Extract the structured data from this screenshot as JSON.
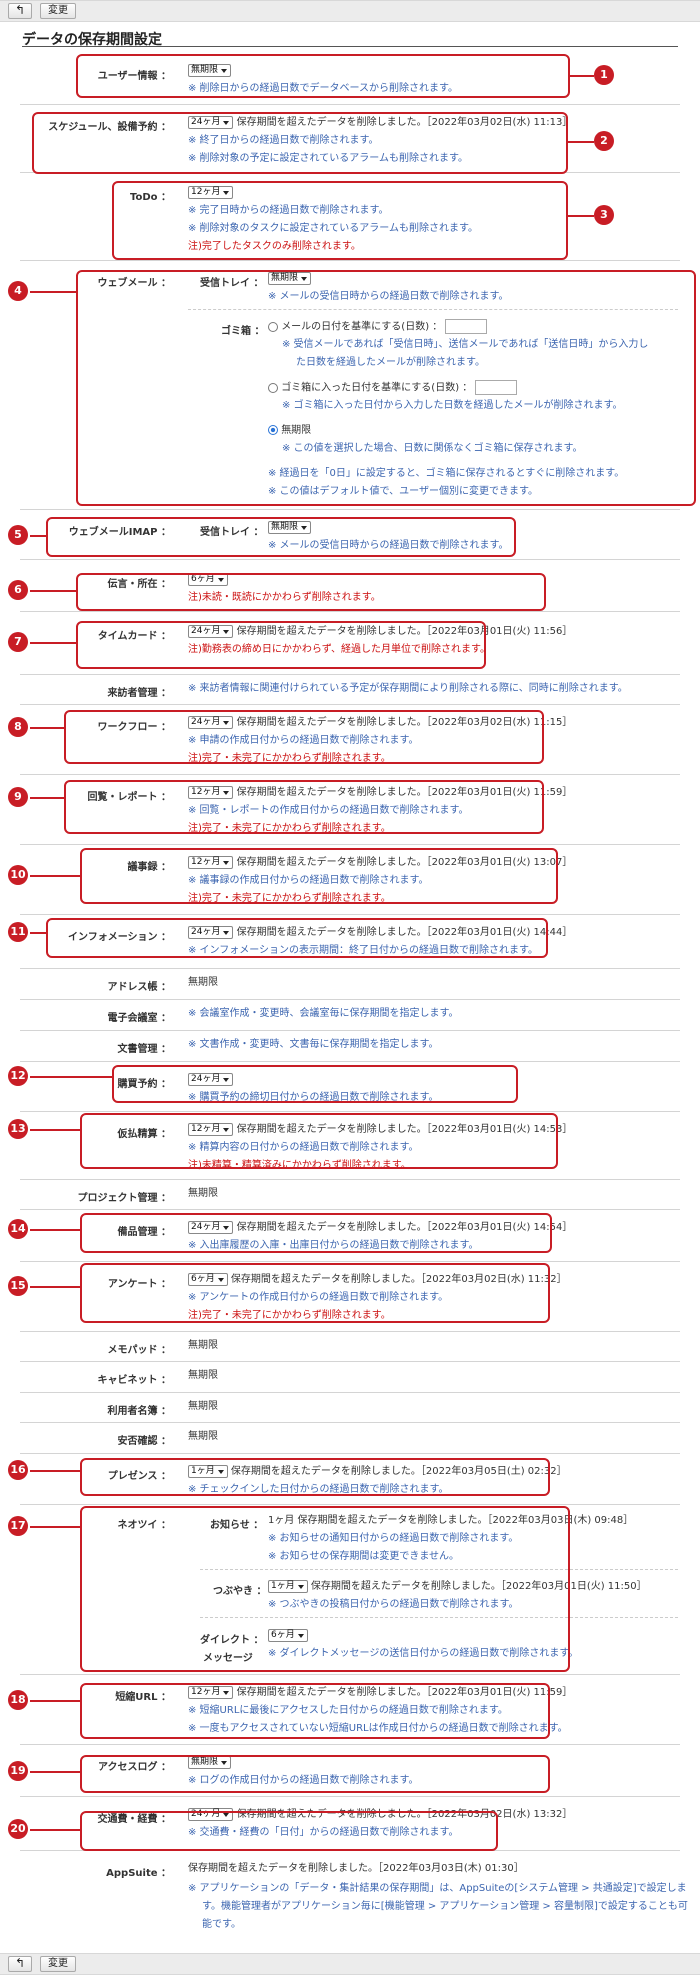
{
  "toolbar": {
    "back_icon": "↰",
    "change_label": "変更"
  },
  "page_title": "データの保存期間設定",
  "user": {
    "label": "ユーザー情報 ：",
    "select": "無期限",
    "note": "※ 削除日からの経過日数でデータベースから削除されます。"
  },
  "schedule": {
    "label": "スケジュール、設備予約 ：",
    "select": "24ヶ月",
    "text": "保存期間を超えたデータを削除しました。［2022年03月02日(水) 11:13］",
    "note1": "※ 終了日からの経過日数で削除されます。",
    "note2": "※ 削除対象の予定に設定されているアラームも削除されます。"
  },
  "todo": {
    "label": "ToDo ：",
    "select": "12ヶ月",
    "note1": "※ 完了日時からの経過日数で削除されます。",
    "note2": "※ 削除対象のタスクに設定されているアラームも削除されます。",
    "note3": "注)完了したタスクのみ削除されます。"
  },
  "webmail": {
    "label": "ウェブメール ：",
    "inbox_label": "受信トレイ ：",
    "inbox_select": "無期限",
    "inbox_note": "※ メールの受信日時からの経過日数で削除されます。",
    "trash_label": "ゴミ箱 ：",
    "opt1": "メールの日付を基準にする(日数) ：",
    "opt1_note1": "※ 受信メールであれば「受信日時」、送信メールであれば「送信日時」から入力し",
    "opt1_note2": "た日数を経過したメールが削除されます。",
    "opt2": "ゴミ箱に入った日付を基準にする(日数) ：",
    "opt2_note": "※ ゴミ箱に入った日付から入力した日数を経過したメールが削除されます。",
    "opt3": "無期限",
    "opt3_note": "※ この値を選択した場合、日数に関係なくゴミ箱に保存されます。",
    "note_a": "※ 経過日を「0日」に設定すると、ゴミ箱に保存されるとすぐに削除されます。",
    "note_b": "※ この値はデフォルト値で、ユーザー個別に変更できます。"
  },
  "imap": {
    "label": "ウェブメールIMAP ：",
    "inbox_label": "受信トレイ ：",
    "inbox_select": "無期限",
    "inbox_note": "※ メールの受信日時からの経過日数で削除されます。"
  },
  "message": {
    "label": "伝言・所在 ：",
    "select": "6ヶ月",
    "note": "注)未読・既読にかかわらず削除されます。"
  },
  "timecard": {
    "label": "タイムカード ：",
    "select": "24ヶ月",
    "text": "保存期間を超えたデータを削除しました。［2022年03月01日(火) 11:56］",
    "note": "注)勤務表の締め日にかかわらず、経過した月単位で削除されます。"
  },
  "visitor": {
    "label": "来訪者管理 ：",
    "note": "※ 来訪者情報に関連付けられている予定が保存期間により削除される際に、同時に削除されます。"
  },
  "workflow": {
    "label": "ワークフロー ：",
    "select": "24ヶ月",
    "text": "保存期間を超えたデータを削除しました。［2022年03月02日(水) 11:15］",
    "note1": "※ 申請の作成日付からの経過日数で削除されます。",
    "note2": "注)完了・未完了にかかわらず削除されます。"
  },
  "circular": {
    "label": "回覧・レポート ：",
    "select": "12ヶ月",
    "text": "保存期間を超えたデータを削除しました。［2022年03月01日(火) 11:59］",
    "note1": "※ 回覧・レポートの作成日付からの経過日数で削除されます。",
    "note2": "注)完了・未完了にかかわらず削除されます。"
  },
  "minutes": {
    "label": "議事録 ：",
    "select": "12ヶ月",
    "text": "保存期間を超えたデータを削除しました。［2022年03月01日(火) 13:07］",
    "note1": "※ 議事録の作成日付からの経過日数で削除されます。",
    "note2": "注)完了・未完了にかかわらず削除されます。"
  },
  "info": {
    "label": "インフォメーション ：",
    "select": "24ヶ月",
    "text": "保存期間を超えたデータを削除しました。［2022年03月01日(火) 14:44］",
    "note": "※ インフォメーションの表示期間：終了日付からの経過日数で削除されます。"
  },
  "address": {
    "label": "アドレス帳 ：",
    "text": "無期限"
  },
  "conference": {
    "label": "電子会議室 ：",
    "note": "※ 会議室作成・変更時、会議室毎に保存期間を指定します。"
  },
  "docs": {
    "label": "文書管理 ：",
    "note": "※ 文書作成・変更時、文書毎に保存期間を指定します。"
  },
  "purchase": {
    "label": "購買予約 ：",
    "select": "24ヶ月",
    "note": "※ 購買予約の締切日付からの経過日数で削除されます。"
  },
  "expense": {
    "label": "仮払精算 ：",
    "select": "12ヶ月",
    "text": "保存期間を超えたデータを削除しました。［2022年03月01日(火) 14:53］",
    "note1": "※ 精算内容の日付からの経過日数で削除されます。",
    "note2": "注)未精算・精算済みにかかわらず削除されます。"
  },
  "project": {
    "label": "プロジェクト管理 ：",
    "text": "無期限"
  },
  "equipment": {
    "label": "備品管理 ：",
    "select": "24ヶ月",
    "text": "保存期間を超えたデータを削除しました。［2022年03月01日(火) 14:54］",
    "note": "※ 入出庫履歴の入庫・出庫日付からの経過日数で削除されます。"
  },
  "survey": {
    "label": "アンケート ：",
    "select": "6ヶ月",
    "text": "保存期間を超えたデータを削除しました。［2022年03月02日(水) 11:32］",
    "note1": "※ アンケートの作成日付からの経過日数で削除されます。",
    "note2": "注)完了・未完了にかかわらず削除されます。"
  },
  "memo": {
    "label": "メモパッド ：",
    "text": "無期限"
  },
  "cabinet": {
    "label": "キャビネット ：",
    "text": "無期限"
  },
  "userlist": {
    "label": "利用者名簿 ：",
    "text": "無期限"
  },
  "safety": {
    "label": "安否確認 ：",
    "text": "無期限"
  },
  "presence": {
    "label": "プレゼンス ：",
    "select": "1ヶ月",
    "text": "保存期間を超えたデータを削除しました。［2022年03月05日(土) 02:32］",
    "note": "※ チェックインした日付からの経過日数で削除されます。"
  },
  "neotwi": {
    "label": "ネオツイ ：",
    "notice_label": "お知らせ ：",
    "notice_text": "1ヶ月 保存期間を超えたデータを削除しました。［2022年03月03日(木) 09:48］",
    "notice_note1": "※ お知らせの通知日付からの経過日数で削除されます。",
    "notice_note2": "※ お知らせの保存期間は変更できません。",
    "tweet_label": "つぶやき ：",
    "tweet_select": "1ヶ月",
    "tweet_text": "保存期間を超えたデータを削除しました。［2022年03月01日(火) 11:50］",
    "tweet_note": "※ つぶやきの投稿日付からの経過日数で削除されます。",
    "dm_label1": "ダイレクト ：",
    "dm_label2": "メッセージ",
    "dm_select": "6ヶ月",
    "dm_note": "※ ダイレクトメッセージの送信日付からの経過日数で削除されます。"
  },
  "shorturl": {
    "label": "短縮URL ：",
    "select": "12ヶ月",
    "text": "保存期間を超えたデータを削除しました。［2022年03月01日(火) 11:59］",
    "note1": "※ 短縮URLに最後にアクセスした日付からの経過日数で削除されます。",
    "note2": "※ 一度もアクセスされていない短縮URLは作成日付からの経過日数で削除されます。"
  },
  "accesslog": {
    "label": "アクセスログ ：",
    "select": "無期限",
    "note": "※ ログの作成日付からの経過日数で削除されます。"
  },
  "travel": {
    "label": "交通費・経費 ：",
    "select": "24ヶ月",
    "text": "保存期間を超えたデータを削除しました。［2022年03月02日(水) 13:32］",
    "note": "※ 交通費・経費の「日付」からの経過日数で削除されます。"
  },
  "appsuite": {
    "label": "AppSuite ：",
    "text": "保存期間を超えたデータを削除しました。［2022年03月03日(木) 01:30］",
    "note1": "※ アプリケーションの「データ・集計結果の保存期間」は、AppSuiteの[システム管理 > 共通設定]で設定しま",
    "note2": "す。機能管理者がアプリケーション毎に[機能管理 > アプリケーション管理 > 容量制限]で設定することも可",
    "note3": "能です。"
  },
  "badges": [
    "1",
    "2",
    "3",
    "4",
    "5",
    "6",
    "7",
    "8",
    "9",
    "10",
    "11",
    "12",
    "13",
    "14",
    "15",
    "16",
    "17",
    "18",
    "19",
    "20"
  ],
  "colors": {
    "annotation": "#c81d25",
    "note_blue": "#3d66b0",
    "note_red": "#cc1111"
  }
}
